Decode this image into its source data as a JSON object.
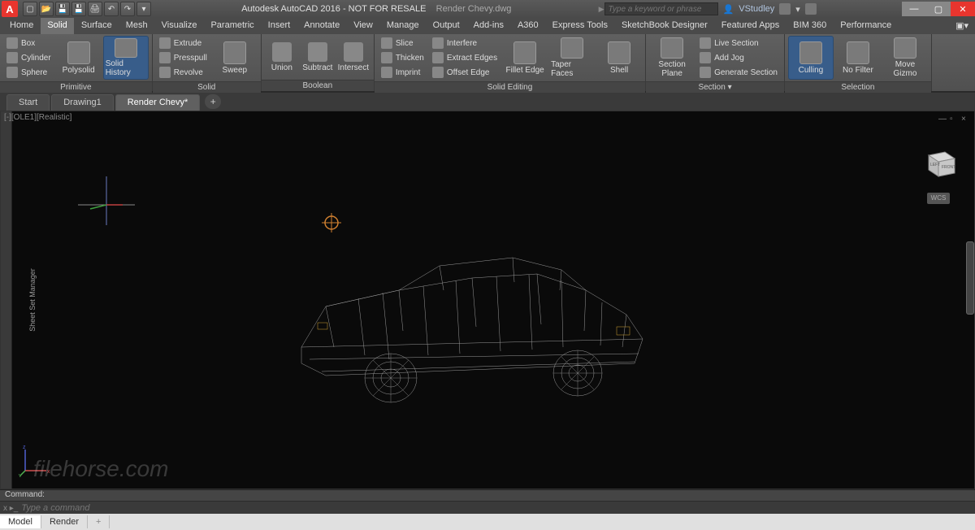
{
  "app": {
    "title_prefix": "Autodesk AutoCAD 2016 - NOT FOR RESALE",
    "filename": "Render Chevy.dwg"
  },
  "search": {
    "placeholder": "Type a keyword or phrase"
  },
  "user": {
    "name": "VStudley"
  },
  "menutabs": [
    "Home",
    "Solid",
    "Surface",
    "Mesh",
    "Visualize",
    "Parametric",
    "Insert",
    "Annotate",
    "View",
    "Manage",
    "Output",
    "Add-ins",
    "A360",
    "Express Tools",
    "SketchBook Designer",
    "Featured Apps",
    "BIM 360",
    "Performance"
  ],
  "active_menutab": "Solid",
  "ribbon": {
    "primitive": {
      "title": "Primitive",
      "small": [
        "Box",
        "Cylinder",
        "Sphere"
      ],
      "big": [
        "Polysolid",
        "Solid History"
      ],
      "active_big": "Solid History"
    },
    "solid": {
      "title": "Solid",
      "small": [
        "Extrude",
        "Presspull",
        "Revolve"
      ],
      "big": [
        "Sweep"
      ]
    },
    "boolean": {
      "title": "Boolean",
      "btns": [
        "Union",
        "Subtract",
        "Intersect"
      ]
    },
    "solidedit": {
      "title": "Solid Editing",
      "col1": [
        "Slice",
        "Thicken",
        "Imprint"
      ],
      "col2": [
        "Interfere",
        "Extract Edges",
        "Offset Edge"
      ],
      "big": [
        "Fillet Edge",
        "Taper Faces",
        "Shell"
      ]
    },
    "section": {
      "title": "Section ▾",
      "big": "Section Plane",
      "small": [
        "Live Section",
        "Add Jog",
        "Generate Section"
      ]
    },
    "selection": {
      "title": "Selection",
      "big": [
        "Culling",
        "No Filter",
        "Move Gizmo"
      ],
      "active_big": "Culling"
    }
  },
  "doctabs": {
    "items": [
      "Start",
      "Drawing1",
      "Render Chevy*"
    ],
    "active": "Render Chevy*"
  },
  "viewport": {
    "label": "[-][OLE1][Realistic]",
    "wcs": "WCS",
    "cube_left": "LEFT",
    "cube_front": "FRONT"
  },
  "sidebar": {
    "label": "Sheet Set Manager"
  },
  "cmd": {
    "label": "Command:",
    "placeholder": "Type a command",
    "prompt": "x ▸_"
  },
  "bottomtabs": {
    "items": [
      "Model",
      "Render",
      "+"
    ],
    "active": "Model"
  },
  "watermark": "filehorse.com",
  "axes": {
    "x": "x",
    "y": "y",
    "z": "z"
  }
}
